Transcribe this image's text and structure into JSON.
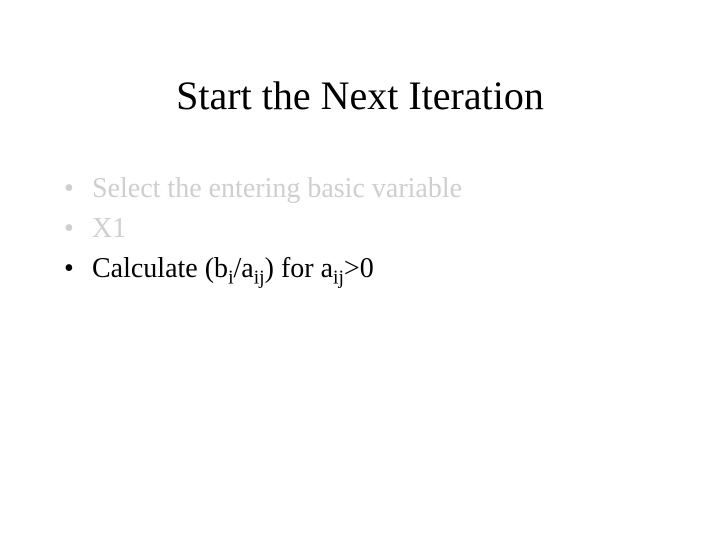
{
  "title": "Start the Next Iteration",
  "bullets": [
    {
      "text": "Select the entering basic variable",
      "faded": true
    },
    {
      "text": "X1",
      "faded": true
    }
  ],
  "bullet3": {
    "t1": "Calculate (b",
    "s1": "i",
    "t2": "/a",
    "s2": "ij",
    "t3": ") for a",
    "s3": "ij",
    "t4": ">0"
  },
  "glyphs": {
    "bullet": "•"
  }
}
